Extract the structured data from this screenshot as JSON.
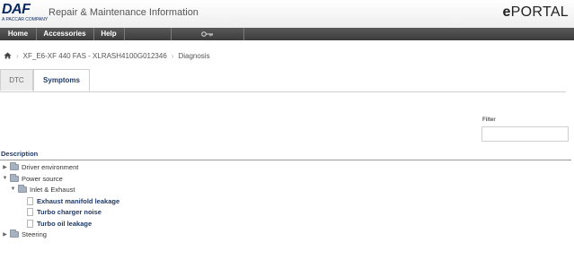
{
  "header": {
    "logo_text": "DAF",
    "logo_subtext": "A PACCAR COMPANY",
    "app_title": "Repair & Maintenance Information",
    "portal_prefix": "e",
    "portal_suffix": "PORTAL"
  },
  "nav": {
    "items": [
      "Home",
      "Accessories",
      "Help"
    ],
    "key_icon": "key-icon"
  },
  "breadcrumb": {
    "home_icon": "home-icon",
    "items": [
      "XF_E6-XF 440 FAS - XLRASH4100G012346",
      "Diagnosis"
    ]
  },
  "tabs": [
    {
      "label": "DTC",
      "active": false
    },
    {
      "label": "Symptoms",
      "active": true
    }
  ],
  "filter": {
    "label": "Filter",
    "value": "",
    "placeholder": ""
  },
  "description": {
    "header": "Description"
  },
  "tree": [
    {
      "label": "Driver environment",
      "type": "folder",
      "expanded": false
    },
    {
      "label": "Power source",
      "type": "folder",
      "expanded": true
    },
    {
      "label": "Inlet & Exhaust",
      "type": "folder",
      "expanded": true
    },
    {
      "label": "Exhaust manifold leakage",
      "type": "document"
    },
    {
      "label": "Turbo charger noise",
      "type": "document"
    },
    {
      "label": "Turbo oil leakage",
      "type": "document"
    },
    {
      "label": "Steering",
      "type": "folder",
      "expanded": false
    }
  ],
  "colors": {
    "brand_navy": "#0b2a63",
    "navbar": "#4a4a4a",
    "link_blue": "#1f3a6a"
  }
}
